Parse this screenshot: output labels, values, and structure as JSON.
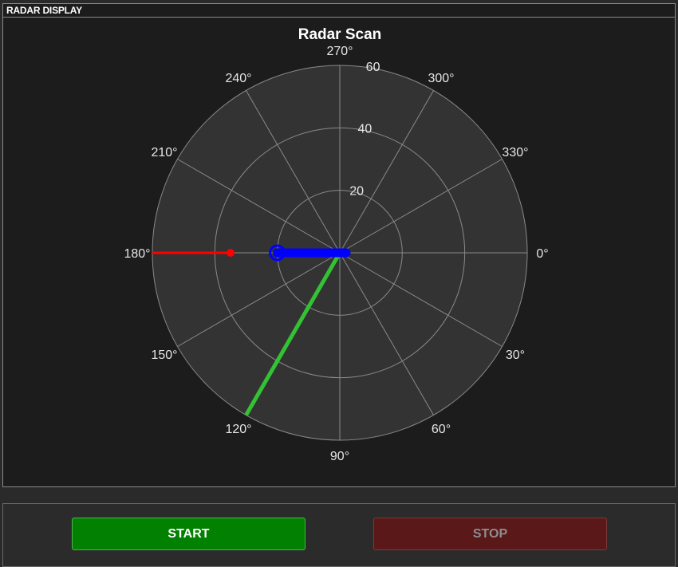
{
  "panel": {
    "title": "RADAR DISPLAY"
  },
  "chart_data": {
    "type": "polar",
    "title": "Radar Scan",
    "angle_ticks": [
      0,
      30,
      60,
      90,
      120,
      150,
      180,
      210,
      240,
      270,
      300,
      330
    ],
    "angle_tick_labels": [
      "0°",
      "30°",
      "60°",
      "90°",
      "120°",
      "150°",
      "180°",
      "210°",
      "240°",
      "270°",
      "300°",
      "330°"
    ],
    "radial_ticks": [
      20,
      40,
      60
    ],
    "radial_tick_labels": [
      "20",
      "40",
      "60"
    ],
    "rlim": [
      0,
      60
    ],
    "grid": true,
    "series": [
      {
        "kind": "sweep-line",
        "angle": 120,
        "r_end": 60,
        "color": "#33c233"
      },
      {
        "kind": "target-line",
        "angle": 180,
        "r_start": 35,
        "r_end": 60,
        "color": "#ff0000"
      },
      {
        "kind": "target-point",
        "angle": 180,
        "r": 35,
        "color": "#ff0000"
      },
      {
        "kind": "thick-bar",
        "angle": 180,
        "r_start": 0,
        "r_end": 20,
        "color": "#0000ff"
      },
      {
        "kind": "ring-marker",
        "angle": 180,
        "r": 20,
        "color": "#0000ff"
      }
    ],
    "colors": {
      "background": "#1c1c1c",
      "plot_face": "#333333",
      "grid": "#8a8a8a",
      "text": "#ffffff"
    }
  },
  "controls": {
    "start_label": "START",
    "stop_label": "STOP"
  }
}
